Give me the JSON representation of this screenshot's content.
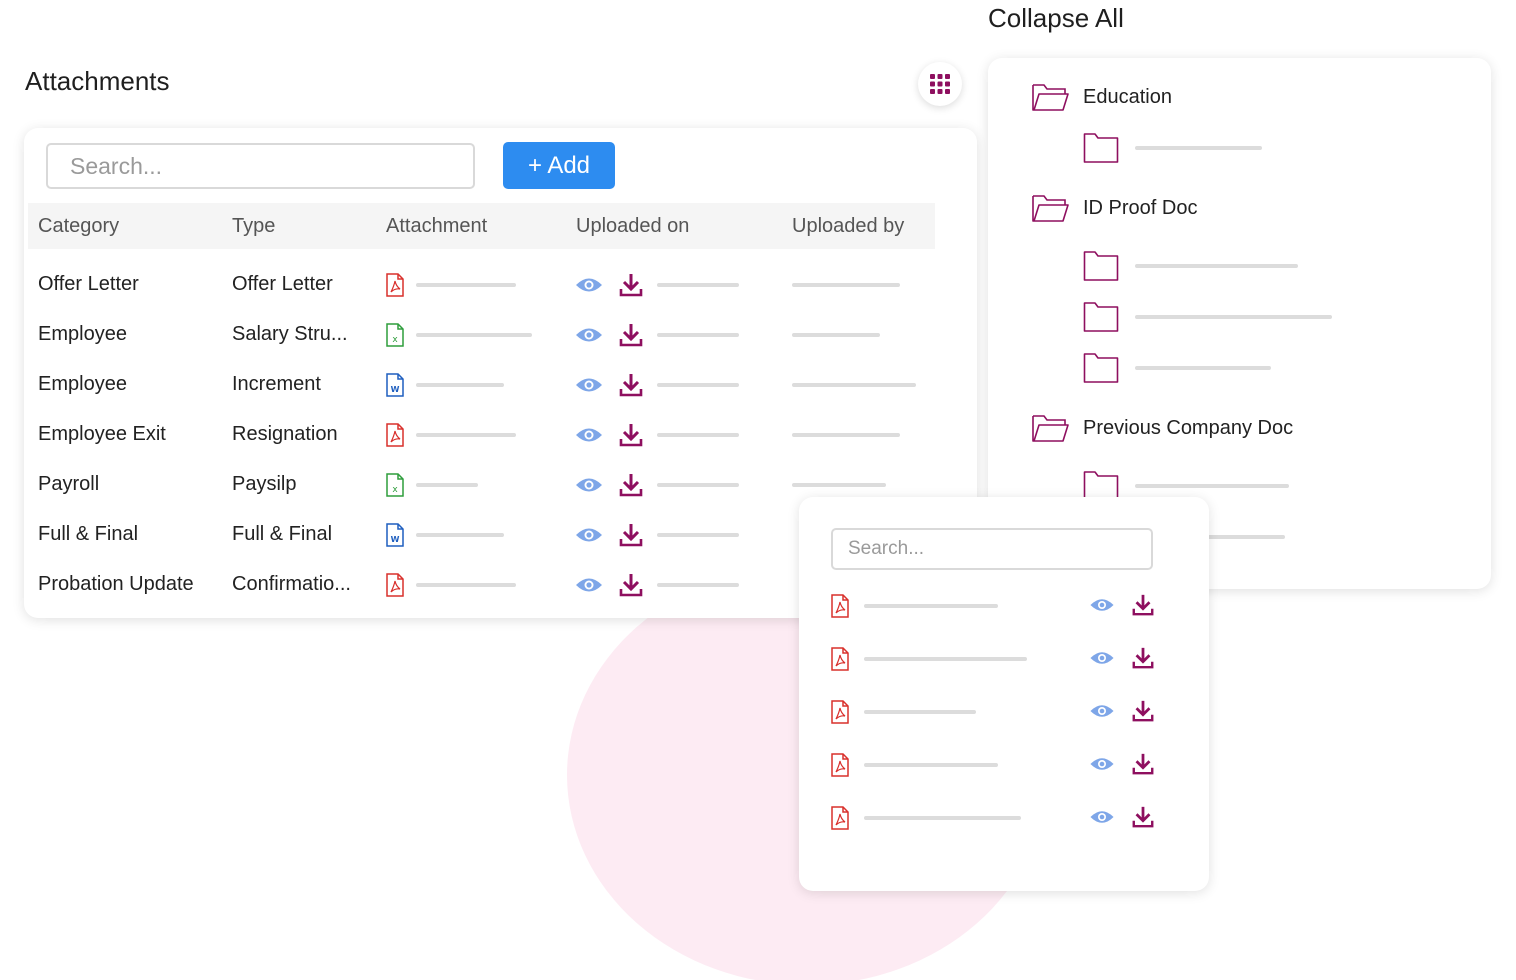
{
  "attachments": {
    "title": "Attachments",
    "search_placeholder": "Search...",
    "add_label": "+ Add",
    "columns": [
      "Category",
      "Type",
      "Attachment",
      "Uploaded on",
      "Uploaded by"
    ],
    "rows": [
      {
        "category": "Offer Letter",
        "type": "Offer Letter",
        "file_icon": "pdf-file-icon"
      },
      {
        "category": "Employee",
        "type": "Salary Stru...",
        "file_icon": "excel-file-icon"
      },
      {
        "category": "Employee",
        "type": "Increment",
        "file_icon": "word-file-icon"
      },
      {
        "category": "Employee Exit",
        "type": "Resignation",
        "file_icon": "pdf-file-icon"
      },
      {
        "category": "Payroll",
        "type": "Paysilp",
        "file_icon": "excel-file-icon"
      },
      {
        "category": "Full & Final",
        "type": "Full & Final",
        "file_icon": "word-file-icon"
      },
      {
        "category": "Probation Update",
        "type": "Confirmatio...",
        "file_icon": "pdf-file-icon"
      }
    ]
  },
  "folders": {
    "collapse_label": "Collapse All",
    "groups": [
      {
        "name": "Education",
        "subfolders": 1
      },
      {
        "name": "ID Proof Doc",
        "subfolders": 3
      },
      {
        "name": "Previous Company Doc",
        "subfolders": 2
      }
    ]
  },
  "popup": {
    "search_placeholder": "Search...",
    "files": 5
  },
  "icons": {
    "grid": "grid-menu-icon",
    "view": "eye-icon",
    "download": "download-icon",
    "folder_open": "folder-open-icon",
    "folder": "folder-icon"
  },
  "colors": {
    "accent": "#8e0f5f",
    "primary_button": "#2d8cf0",
    "pdf": "#d9302c",
    "excel": "#2e9d3c",
    "word": "#1f5fbf",
    "eye": "#7ea6e8",
    "blob": "#fdebf3"
  }
}
